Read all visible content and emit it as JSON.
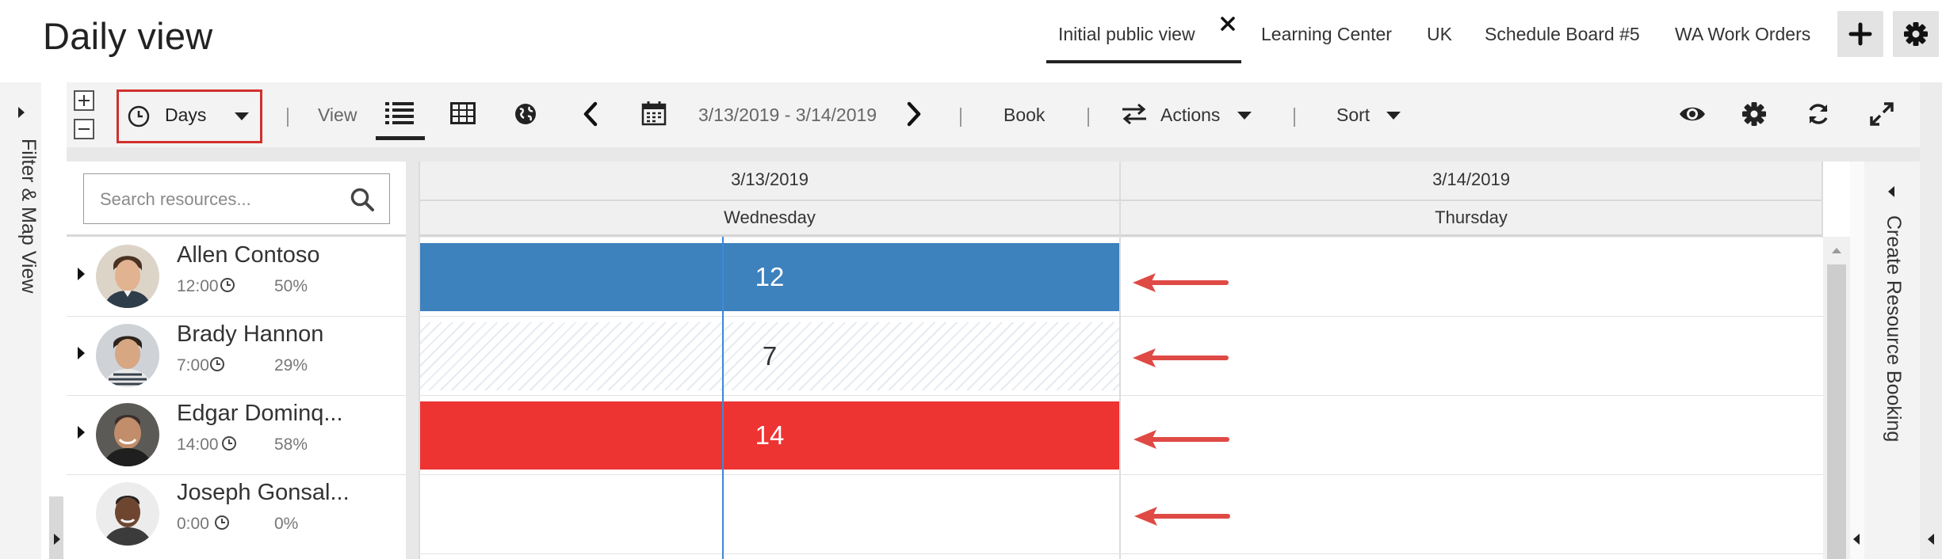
{
  "page": {
    "title": "Daily view"
  },
  "view_tabs": [
    {
      "label": "Initial public view",
      "active": true
    },
    {
      "label": "Learning Center"
    },
    {
      "label": "UK"
    },
    {
      "label": "Schedule Board #5"
    },
    {
      "label": "WA Work Orders"
    }
  ],
  "header_buttons": {
    "add_icon": "plus-icon",
    "settings_icon": "gear-icon",
    "close_tab_icon": "close-icon"
  },
  "toolbar": {
    "time_scale": "Days",
    "view_label": "View",
    "date_range": "3/13/2019 - 3/14/2019",
    "book_label": "Book",
    "actions_label": "Actions",
    "sort_label": "Sort",
    "icons": [
      "expand-plus-icon",
      "collapse-minus-icon",
      "clock-icon",
      "list-view-icon",
      "grid-view-icon",
      "globe-map-icon",
      "chevron-left-icon",
      "calendar-icon",
      "chevron-right-icon",
      "swap-arrows-icon",
      "eye-icon",
      "gear-icon",
      "refresh-icon",
      "fullscreen-icon"
    ]
  },
  "filter_panel": {
    "label": "Filter & Map View"
  },
  "create_panel": {
    "label": "Create Resource Booking"
  },
  "search": {
    "placeholder": "Search resources..."
  },
  "columns": [
    {
      "date": "3/13/2019",
      "day": "Wednesday"
    },
    {
      "date": "3/14/2019",
      "day": "Thursday"
    }
  ],
  "resources": [
    {
      "name": "Allen Contoso",
      "hours": "12:00",
      "utilization": "50%",
      "booked_count": "12",
      "cell_style": "blue",
      "has_expander": true
    },
    {
      "name": "Brady Hannon",
      "hours": "7:00",
      "utilization": "29%",
      "booked_count": "7",
      "cell_style": "hatched",
      "has_expander": true
    },
    {
      "name": "Edgar Dominq...",
      "hours": "14:00",
      "utilization": "58%",
      "booked_count": "14",
      "cell_style": "red",
      "has_expander": true
    },
    {
      "name": "Joseph Gonsal...",
      "hours": "0:00",
      "utilization": "0%",
      "booked_count": "",
      "cell_style": "empty",
      "has_expander": false
    }
  ],
  "colors": {
    "blue_booking": "#3d81bd",
    "red_booking": "#ee3333",
    "highlight_border": "#d0312d",
    "annotation_arrow": "#df4a45",
    "current_day_line": "#3b8ad8"
  }
}
